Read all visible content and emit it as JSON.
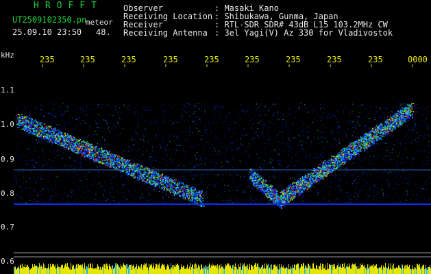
{
  "header": {
    "brand": "HROFFT",
    "filename": "UT2509102350.pn",
    "mode": "meteor",
    "datetime": "25.09.10 23:50",
    "count": "48.",
    "observer_label": "Observer",
    "observer_value": ": Masaki Kano",
    "location_label": "Receiving Location",
    "location_value": ": Shibukawa, Gunma, Japan",
    "receiver_label": "Receiver",
    "receiver_value": ": RTL-SDR SDR# 43dB L15 103.2MHz CW",
    "antenna_label": "Receiving Antenna",
    "antenna_value": ": 3el Yagi(V) Az 330 for Vladivostok"
  },
  "axis": {
    "unit": "kHz",
    "time_ticks": [
      "235",
      "235",
      "235",
      "235",
      "235",
      "235",
      "235",
      "235",
      "235",
      "0000"
    ],
    "freq_ticks": [
      "1.1",
      "1.0",
      "0.9",
      "0.8",
      "0.7",
      "0.6"
    ]
  },
  "colors": {
    "label_green": "#19d43a",
    "tick_yellow": "#e6e600",
    "trace_red": "#e01010",
    "trace_cyan": "#19b8ff",
    "noise_blue": "#0a2cff"
  }
}
